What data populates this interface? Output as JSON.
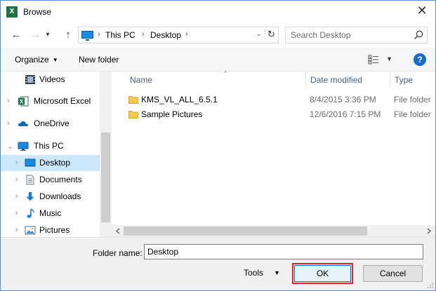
{
  "window": {
    "title": "Browse",
    "app_icon_letter": "X",
    "close_glyph": "✕"
  },
  "nav": {
    "back_glyph": "←",
    "forward_glyph": "→",
    "up_glyph": "↑",
    "dropdown_glyph": "▾"
  },
  "address": {
    "breadcrumbs": [
      "This PC",
      "Desktop"
    ],
    "separator": "›",
    "dropdown_glyph": "⌄",
    "refresh_glyph": "↻"
  },
  "search": {
    "placeholder": "Search Desktop",
    "icon": "search-icon"
  },
  "toolbar": {
    "organize_label": "Organize",
    "new_folder_label": "New folder",
    "caret": "▼",
    "help_label": "?"
  },
  "sidebar": {
    "items": [
      {
        "label": "Videos",
        "icon": "videos-icon",
        "expander": ""
      },
      {
        "label": "Microsoft Excel",
        "icon": "excel-icon",
        "expander": "›"
      },
      {
        "label": "OneDrive",
        "icon": "onedrive-icon",
        "expander": "›"
      },
      {
        "label": "This PC",
        "icon": "this-pc-icon",
        "expander": "⌄"
      },
      {
        "label": "Desktop",
        "icon": "desktop-icon",
        "expander": "›",
        "selected": true
      },
      {
        "label": "Documents",
        "icon": "documents-icon",
        "expander": "›"
      },
      {
        "label": "Downloads",
        "icon": "downloads-icon",
        "expander": "›"
      },
      {
        "label": "Music",
        "icon": "music-icon",
        "expander": "›"
      },
      {
        "label": "Pictures",
        "icon": "pictures-icon",
        "expander": "›"
      }
    ]
  },
  "file_list": {
    "columns": [
      "Name",
      "Date modified",
      "Type"
    ],
    "sort_glyph": "^",
    "rows": [
      {
        "name": "KMS_VL_ALL_6.5.1",
        "date": "8/4/2015 3:36 PM",
        "type": "File folder"
      },
      {
        "name": "Sample Pictures",
        "date": "12/6/2016 7:15 PM",
        "type": "File folder"
      }
    ]
  },
  "footer": {
    "folder_name_label": "Folder name:",
    "folder_name_value": "Desktop",
    "tools_label": "Tools",
    "tools_caret": "▼",
    "ok_label": "OK",
    "cancel_label": "Cancel"
  },
  "colors": {
    "accent": "#0078d7",
    "selection": "#cce8ff",
    "highlight": "#e0262b",
    "folder": "#f6c951"
  }
}
